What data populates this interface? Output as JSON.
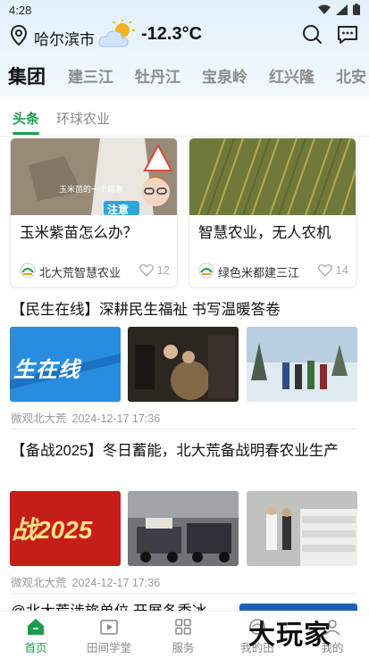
{
  "status_bar": {
    "time": "4:28"
  },
  "header": {
    "city": "哈尔滨市",
    "temperature": "-12.3°C",
    "weather_icon": "partly-cloudy-icon"
  },
  "region_tabs": [
    "集团",
    "建三江",
    "牡丹江",
    "宝泉岭",
    "红兴隆",
    "北安"
  ],
  "sub_tabs": [
    "头条",
    "环球农业"
  ],
  "cards": [
    {
      "title": "玉米紫苗怎么办？",
      "author": "北大荒智慧农业",
      "likes": "12",
      "image_caption": "玉米苗的一个现象",
      "badge": "注意"
    },
    {
      "title": "智慧农业，无人农机",
      "author": "绿色米都建三江",
      "likes": "14"
    }
  ],
  "articles": [
    {
      "title": "【民生在线】深耕民生福祉 书写温暖答卷",
      "thumb1_text": "生在线",
      "source": "微观北大荒",
      "date": "2024-12-17 17:36"
    },
    {
      "title": "【备战2025】冬日蓄能，北大荒备战明春农业生产",
      "thumb1_text": "战2025",
      "source": "微观北大荒",
      "date": "2024-12-17 17:36"
    },
    {
      "title": "@北大荒涉旅单位 开展冬季冰"
    }
  ],
  "bottom_nav": [
    {
      "label": "首页",
      "icon": "home-icon"
    },
    {
      "label": "田间学堂",
      "icon": "video-icon"
    },
    {
      "label": "服务",
      "icon": "grid-icon"
    },
    {
      "label": "我的田",
      "icon": "field-icon"
    },
    {
      "label": "我的",
      "icon": "user-icon"
    }
  ],
  "watermark": "大玩家",
  "colors": {
    "accent": "#1a9c4a",
    "tab_inactive": "#8c8c8c"
  }
}
